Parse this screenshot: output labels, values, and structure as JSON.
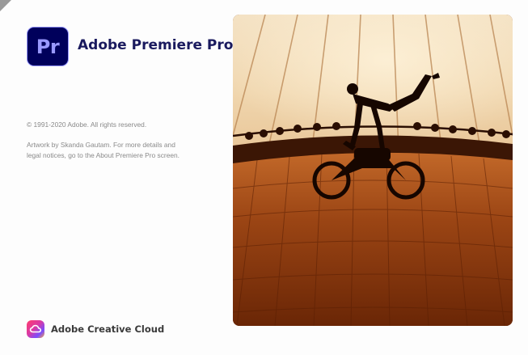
{
  "window": {
    "app_logo_text": "Pr",
    "app_title": "Adobe Premiere Pro",
    "copyright": "© 1991-2020 Adobe. All rights reserved.",
    "artwork_credit_lines": [
      "Artwork by Skanda Gautam. For more details and",
      "legal notices, go to the About Premiere Pro screen."
    ],
    "brand_label": "Adobe Creative Cloud"
  },
  "colors": {
    "logo_background": "#00005b",
    "logo_text": "#9999ff",
    "title_text": "#1a1a5e",
    "secondary_text": "#8a8a8a"
  },
  "icons": {
    "app_logo": "premiere-pro-icon",
    "brand": "creative-cloud-icon"
  },
  "artwork": {
    "subject": "silhouette-of-stunt-rider-on-motorcycle-in-wooden-well-of-death"
  }
}
